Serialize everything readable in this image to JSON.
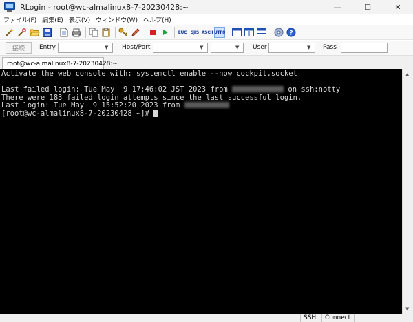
{
  "window": {
    "title": "RLogin - root@wc-almalinux8-7-20230428:~",
    "minimize": "—",
    "maximize": "☐",
    "close": "✕"
  },
  "menu": [
    "ファイル(F)",
    "編集(E)",
    "表示(V)",
    "ウィンドウ(W)",
    "ヘルプ(H)"
  ],
  "toolbar": {
    "euc": "EUC",
    "sjis": "SJIS",
    "ascii": "ASCII",
    "utf8": "UTF8"
  },
  "connbar": {
    "connect_button": "接続",
    "entry_label": "Entry",
    "host_port_label": "Host/Port",
    "user_label": "User",
    "pass_label": "Pass"
  },
  "tab": {
    "label": "root@wc-almalinux8-7-20230428:~"
  },
  "terminal": {
    "line1": "Activate the web console with: systemctl enable --now cockpit.socket",
    "line2": "",
    "line3_a": "Last failed login: Tue May  9 17:46:02 JST 2023 from ",
    "line3_b": " on ssh:notty",
    "line4": "There were 183 failed login attempts since the last successful login.",
    "line5_a": "Last login: Tue May  9 15:52:20 2023 from ",
    "line6": "[root@wc-almalinux8-7-20230428 ~]# "
  },
  "status": {
    "protocol": "SSH",
    "state": "Connect"
  },
  "colors": {
    "terminal_bg": "#000000",
    "terminal_fg": "#d8d8d8",
    "active_encoding": "#cfe4ff"
  }
}
